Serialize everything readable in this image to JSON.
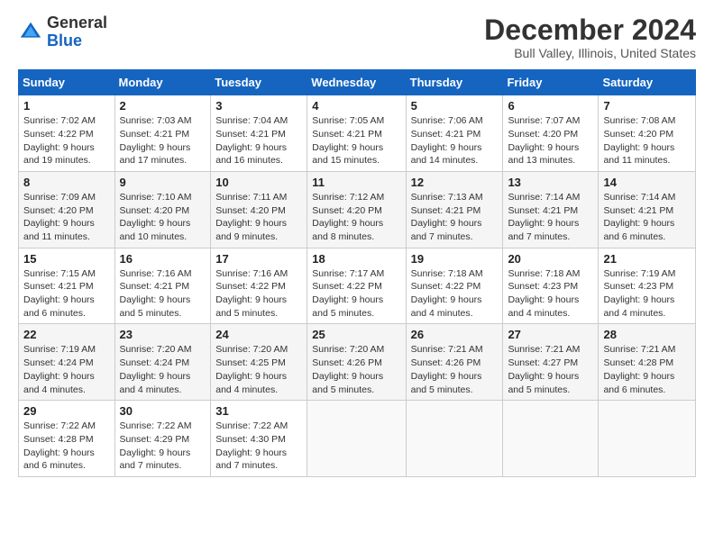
{
  "logo": {
    "text_general": "General",
    "text_blue": "Blue"
  },
  "header": {
    "month_title": "December 2024",
    "location": "Bull Valley, Illinois, United States"
  },
  "days_of_week": [
    "Sunday",
    "Monday",
    "Tuesday",
    "Wednesday",
    "Thursday",
    "Friday",
    "Saturday"
  ],
  "weeks": [
    [
      {
        "day": "1",
        "sunrise": "7:02 AM",
        "sunset": "4:22 PM",
        "daylight": "9 hours and 19 minutes."
      },
      {
        "day": "2",
        "sunrise": "7:03 AM",
        "sunset": "4:21 PM",
        "daylight": "9 hours and 17 minutes."
      },
      {
        "day": "3",
        "sunrise": "7:04 AM",
        "sunset": "4:21 PM",
        "daylight": "9 hours and 16 minutes."
      },
      {
        "day": "4",
        "sunrise": "7:05 AM",
        "sunset": "4:21 PM",
        "daylight": "9 hours and 15 minutes."
      },
      {
        "day": "5",
        "sunrise": "7:06 AM",
        "sunset": "4:21 PM",
        "daylight": "9 hours and 14 minutes."
      },
      {
        "day": "6",
        "sunrise": "7:07 AM",
        "sunset": "4:20 PM",
        "daylight": "9 hours and 13 minutes."
      },
      {
        "day": "7",
        "sunrise": "7:08 AM",
        "sunset": "4:20 PM",
        "daylight": "9 hours and 11 minutes."
      }
    ],
    [
      {
        "day": "8",
        "sunrise": "7:09 AM",
        "sunset": "4:20 PM",
        "daylight": "9 hours and 11 minutes."
      },
      {
        "day": "9",
        "sunrise": "7:10 AM",
        "sunset": "4:20 PM",
        "daylight": "9 hours and 10 minutes."
      },
      {
        "day": "10",
        "sunrise": "7:11 AM",
        "sunset": "4:20 PM",
        "daylight": "9 hours and 9 minutes."
      },
      {
        "day": "11",
        "sunrise": "7:12 AM",
        "sunset": "4:20 PM",
        "daylight": "9 hours and 8 minutes."
      },
      {
        "day": "12",
        "sunrise": "7:13 AM",
        "sunset": "4:21 PM",
        "daylight": "9 hours and 7 minutes."
      },
      {
        "day": "13",
        "sunrise": "7:14 AM",
        "sunset": "4:21 PM",
        "daylight": "9 hours and 7 minutes."
      },
      {
        "day": "14",
        "sunrise": "7:14 AM",
        "sunset": "4:21 PM",
        "daylight": "9 hours and 6 minutes."
      }
    ],
    [
      {
        "day": "15",
        "sunrise": "7:15 AM",
        "sunset": "4:21 PM",
        "daylight": "9 hours and 6 minutes."
      },
      {
        "day": "16",
        "sunrise": "7:16 AM",
        "sunset": "4:21 PM",
        "daylight": "9 hours and 5 minutes."
      },
      {
        "day": "17",
        "sunrise": "7:16 AM",
        "sunset": "4:22 PM",
        "daylight": "9 hours and 5 minutes."
      },
      {
        "day": "18",
        "sunrise": "7:17 AM",
        "sunset": "4:22 PM",
        "daylight": "9 hours and 5 minutes."
      },
      {
        "day": "19",
        "sunrise": "7:18 AM",
        "sunset": "4:22 PM",
        "daylight": "9 hours and 4 minutes."
      },
      {
        "day": "20",
        "sunrise": "7:18 AM",
        "sunset": "4:23 PM",
        "daylight": "9 hours and 4 minutes."
      },
      {
        "day": "21",
        "sunrise": "7:19 AM",
        "sunset": "4:23 PM",
        "daylight": "9 hours and 4 minutes."
      }
    ],
    [
      {
        "day": "22",
        "sunrise": "7:19 AM",
        "sunset": "4:24 PM",
        "daylight": "9 hours and 4 minutes."
      },
      {
        "day": "23",
        "sunrise": "7:20 AM",
        "sunset": "4:24 PM",
        "daylight": "9 hours and 4 minutes."
      },
      {
        "day": "24",
        "sunrise": "7:20 AM",
        "sunset": "4:25 PM",
        "daylight": "9 hours and 4 minutes."
      },
      {
        "day": "25",
        "sunrise": "7:20 AM",
        "sunset": "4:26 PM",
        "daylight": "9 hours and 5 minutes."
      },
      {
        "day": "26",
        "sunrise": "7:21 AM",
        "sunset": "4:26 PM",
        "daylight": "9 hours and 5 minutes."
      },
      {
        "day": "27",
        "sunrise": "7:21 AM",
        "sunset": "4:27 PM",
        "daylight": "9 hours and 5 minutes."
      },
      {
        "day": "28",
        "sunrise": "7:21 AM",
        "sunset": "4:28 PM",
        "daylight": "9 hours and 6 minutes."
      }
    ],
    [
      {
        "day": "29",
        "sunrise": "7:22 AM",
        "sunset": "4:28 PM",
        "daylight": "9 hours and 6 minutes."
      },
      {
        "day": "30",
        "sunrise": "7:22 AM",
        "sunset": "4:29 PM",
        "daylight": "9 hours and 7 minutes."
      },
      {
        "day": "31",
        "sunrise": "7:22 AM",
        "sunset": "4:30 PM",
        "daylight": "9 hours and 7 minutes."
      },
      null,
      null,
      null,
      null
    ]
  ],
  "labels": {
    "sunrise": "Sunrise:",
    "sunset": "Sunset:",
    "daylight": "Daylight:"
  }
}
